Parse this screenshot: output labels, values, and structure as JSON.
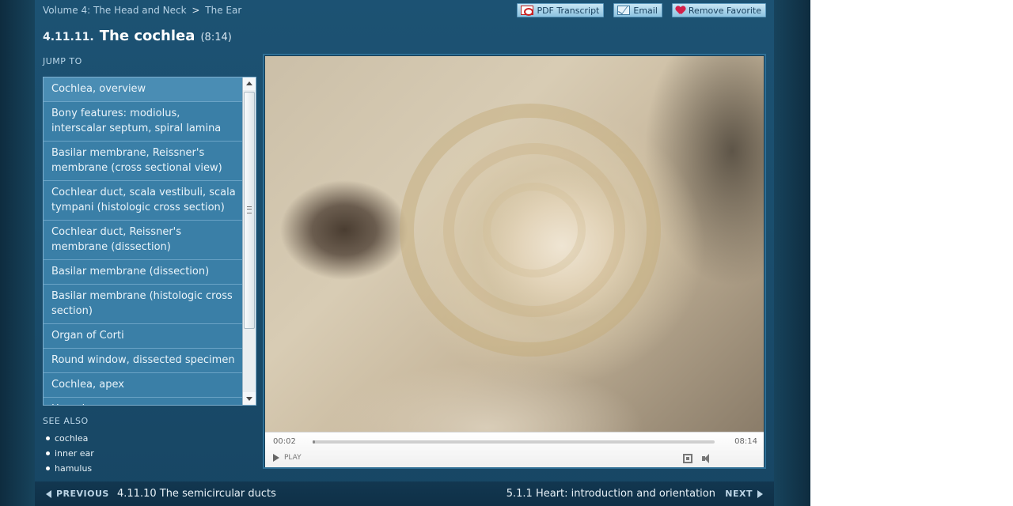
{
  "breadcrumb": {
    "volume": "Volume 4: The Head and Neck",
    "separator": ">",
    "section": "The Ear"
  },
  "toolbar": {
    "pdf_label": "PDF Transcript",
    "email_label": "Email",
    "favorite_label": "Remove Favorite"
  },
  "title": {
    "number": "4.11.11.",
    "name": "The cochlea",
    "duration": "(8:14)"
  },
  "jump_to": {
    "label": "JUMP TO",
    "items": [
      "Cochlea, overview",
      "Bony features: modiolus, interscalar septum, spiral lamina",
      "Basilar membrane, Reissner's membrane (cross sectional view)",
      "Cochlear duct, scala vestibuli, scala tympani (histologic cross section)",
      "Cochlear duct, Reissner's membrane (dissection)",
      "Basilar membrane (dissection)",
      "Basilar membrane (histologic cross section)",
      "Organ of Corti",
      "Round window, dissected specimen",
      "Cochlea, apex",
      "Hamulus"
    ]
  },
  "see_also": {
    "label": "SEE ALSO",
    "items": [
      "cochlea",
      "inner ear",
      "hamulus"
    ]
  },
  "player": {
    "current_time": "00:02",
    "total_time": "08:14",
    "play_label": "PLAY",
    "progress_fraction": 0.004
  },
  "footer": {
    "prev_label": "PREVIOUS",
    "prev_title": "4.11.10 The semicircular ducts",
    "next_label": "NEXT",
    "next_title": "5.1.1 Heart: introduction and orientation"
  },
  "colors": {
    "panel": "#1c5273",
    "list_item": "#3a7fa7",
    "footer": "#123750",
    "favorite_heart": "#d3204a"
  }
}
